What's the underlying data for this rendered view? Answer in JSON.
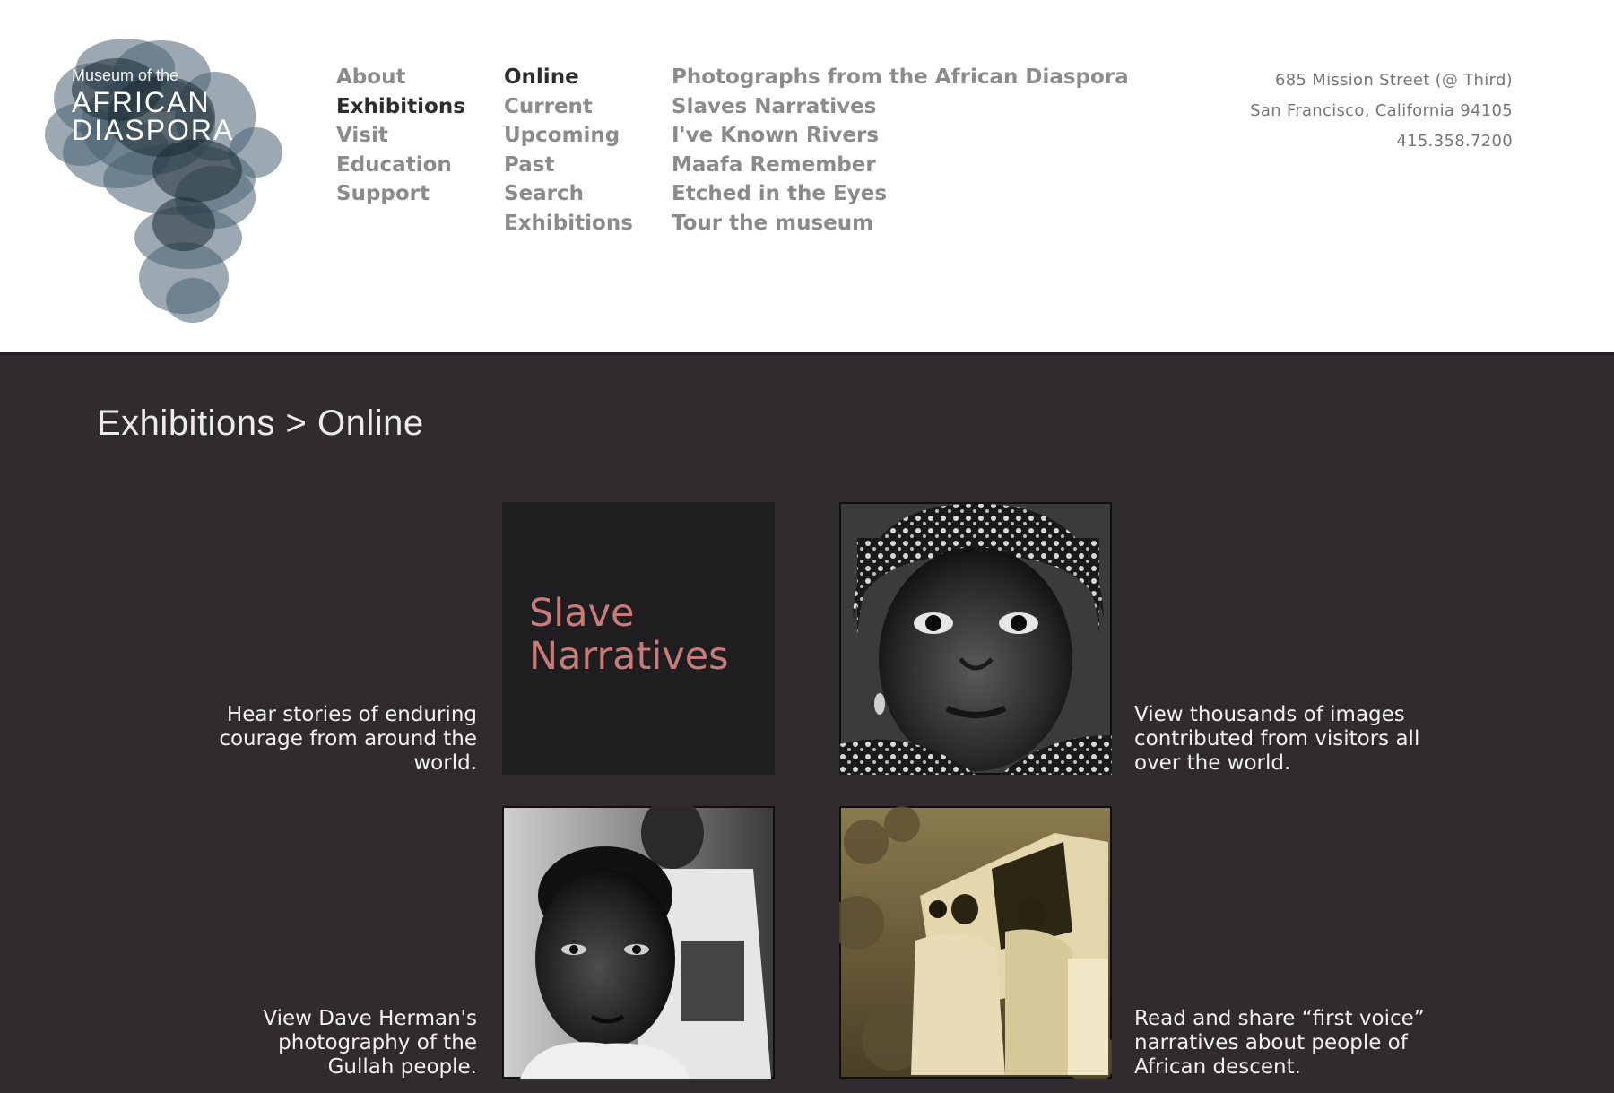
{
  "logo": {
    "line1": "Museum of the",
    "line2": "AFRICAN",
    "line3": "DIASPORA",
    "color": "#4a6372"
  },
  "nav": {
    "main": [
      "About",
      "Exhibitions",
      "Visit",
      "Education",
      "Support"
    ],
    "main_active": "Exhibitions",
    "exhibitions": [
      "Online",
      "Current",
      "Upcoming",
      "Past",
      "Search Exhibitions"
    ],
    "exhibitions_display": [
      "Online",
      "Current",
      "Upcoming",
      "Past",
      "Search",
      "Exhibitions"
    ],
    "exhibitions_active": "Online",
    "online": [
      "Photographs from the African Diaspora",
      "Slaves Narratives",
      "I've Known Rivers",
      "Maafa Remember",
      "Etched in the Eyes",
      "Tour the museum"
    ]
  },
  "address": {
    "street": "685 Mission Street (@ Third)",
    "city": "San Francisco, California 94105",
    "phone": "415.358.7200"
  },
  "breadcrumb": "Exhibitions > Online",
  "tiles": {
    "slave_narratives": {
      "title_line1": "Slave",
      "title_line2": "Narratives",
      "description": "Hear stories of enduring courage from around the world."
    },
    "photographs": {
      "image": "portrait-girl-headscarf-photo",
      "description": "View thousands of images contributed from visitors all over the world."
    },
    "gullah": {
      "image": "portrait-boy-photo",
      "description": "View Dave Herman's photography of the Gullah people."
    },
    "first_voice": {
      "image": "sepia-people-vehicle-photo",
      "description": "Read and share “first voice” narratives about people of African descent."
    }
  },
  "colors": {
    "background_dark": "#302b2f",
    "tile_dark": "#201d21",
    "accent": "#c77c79",
    "nav_inactive": "#8b8b8d",
    "nav_active": "#2e2a2d"
  }
}
